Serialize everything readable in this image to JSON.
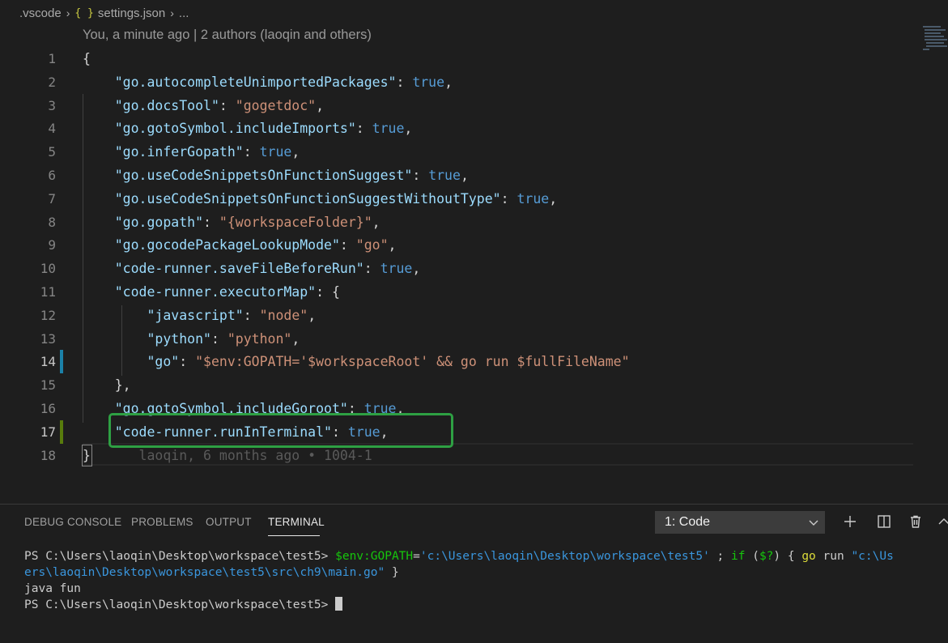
{
  "breadcrumb": {
    "folder": ".vscode",
    "file_icon_text": "{ }",
    "file": "settings.json",
    "more": "..."
  },
  "codelens": "You, a minute ago | 2 authors (laoqin and others)",
  "editor": {
    "line_numbers": [
      "1",
      "2",
      "3",
      "4",
      "5",
      "6",
      "7",
      "8",
      "9",
      "10",
      "11",
      "12",
      "13",
      "14",
      "15",
      "16",
      "17",
      "18"
    ],
    "lines": [
      [
        {
          "t": "{",
          "c": "p"
        }
      ],
      [
        {
          "t": "    ",
          "c": "p"
        },
        {
          "t": "\"go.autocompleteUnimportedPackages\"",
          "c": "k"
        },
        {
          "t": ": ",
          "c": "p"
        },
        {
          "t": "true",
          "c": "b"
        },
        {
          "t": ",",
          "c": "p"
        }
      ],
      [
        {
          "t": "    ",
          "c": "p"
        },
        {
          "t": "\"go.docsTool\"",
          "c": "k"
        },
        {
          "t": ": ",
          "c": "p"
        },
        {
          "t": "\"gogetdoc\"",
          "c": "s"
        },
        {
          "t": ",",
          "c": "p"
        }
      ],
      [
        {
          "t": "    ",
          "c": "p"
        },
        {
          "t": "\"go.gotoSymbol.includeImports\"",
          "c": "k"
        },
        {
          "t": ": ",
          "c": "p"
        },
        {
          "t": "true",
          "c": "b"
        },
        {
          "t": ",",
          "c": "p"
        }
      ],
      [
        {
          "t": "    ",
          "c": "p"
        },
        {
          "t": "\"go.inferGopath\"",
          "c": "k"
        },
        {
          "t": ": ",
          "c": "p"
        },
        {
          "t": "true",
          "c": "b"
        },
        {
          "t": ",",
          "c": "p"
        }
      ],
      [
        {
          "t": "    ",
          "c": "p"
        },
        {
          "t": "\"go.useCodeSnippetsOnFunctionSuggest\"",
          "c": "k"
        },
        {
          "t": ": ",
          "c": "p"
        },
        {
          "t": "true",
          "c": "b"
        },
        {
          "t": ",",
          "c": "p"
        }
      ],
      [
        {
          "t": "    ",
          "c": "p"
        },
        {
          "t": "\"go.useCodeSnippetsOnFunctionSuggestWithoutType\"",
          "c": "k"
        },
        {
          "t": ": ",
          "c": "p"
        },
        {
          "t": "true",
          "c": "b"
        },
        {
          "t": ",",
          "c": "p"
        }
      ],
      [
        {
          "t": "    ",
          "c": "p"
        },
        {
          "t": "\"go.gopath\"",
          "c": "k"
        },
        {
          "t": ": ",
          "c": "p"
        },
        {
          "t": "\"{workspaceFolder}\"",
          "c": "s"
        },
        {
          "t": ",",
          "c": "p"
        }
      ],
      [
        {
          "t": "    ",
          "c": "p"
        },
        {
          "t": "\"go.gocodePackageLookupMode\"",
          "c": "k"
        },
        {
          "t": ": ",
          "c": "p"
        },
        {
          "t": "\"go\"",
          "c": "s"
        },
        {
          "t": ",",
          "c": "p"
        }
      ],
      [
        {
          "t": "    ",
          "c": "p"
        },
        {
          "t": "\"code-runner.saveFileBeforeRun\"",
          "c": "k"
        },
        {
          "t": ": ",
          "c": "p"
        },
        {
          "t": "true",
          "c": "b"
        },
        {
          "t": ",",
          "c": "p"
        }
      ],
      [
        {
          "t": "    ",
          "c": "p"
        },
        {
          "t": "\"code-runner.executorMap\"",
          "c": "k"
        },
        {
          "t": ": {",
          "c": "p"
        }
      ],
      [
        {
          "t": "        ",
          "c": "p"
        },
        {
          "t": "\"javascript\"",
          "c": "k"
        },
        {
          "t": ": ",
          "c": "p"
        },
        {
          "t": "\"node\"",
          "c": "s"
        },
        {
          "t": ",",
          "c": "p"
        }
      ],
      [
        {
          "t": "        ",
          "c": "p"
        },
        {
          "t": "\"python\"",
          "c": "k"
        },
        {
          "t": ": ",
          "c": "p"
        },
        {
          "t": "\"python\"",
          "c": "s"
        },
        {
          "t": ",",
          "c": "p"
        }
      ],
      [
        {
          "t": "        ",
          "c": "p"
        },
        {
          "t": "\"go\"",
          "c": "k"
        },
        {
          "t": ": ",
          "c": "p"
        },
        {
          "t": "\"$env:GOPATH='$workspaceRoot' && go run $fullFileName\"",
          "c": "s"
        }
      ],
      [
        {
          "t": "    },",
          "c": "p"
        }
      ],
      [
        {
          "t": "    ",
          "c": "p"
        },
        {
          "t": "\"go.gotoSymbol.includeGoroot\"",
          "c": "k"
        },
        {
          "t": ": ",
          "c": "p"
        },
        {
          "t": "true",
          "c": "b"
        },
        {
          "t": ",",
          "c": "p"
        }
      ],
      [
        {
          "t": "    ",
          "c": "p"
        },
        {
          "t": "\"code-runner.runInTerminal\"",
          "c": "k"
        },
        {
          "t": ": ",
          "c": "p"
        },
        {
          "t": "true",
          "c": "b"
        },
        {
          "t": ",",
          "c": "p"
        }
      ],
      [
        {
          "t": "}",
          "c": "p"
        },
        {
          "t": "      laoqin, 6 months ago • 1004-1",
          "c": "blame"
        }
      ]
    ]
  },
  "panel": {
    "tabs": [
      {
        "label": "DEBUG CONSOLE",
        "active": false
      },
      {
        "label": "PROBLEMS",
        "active": false
      },
      {
        "label": "OUTPUT",
        "active": false
      },
      {
        "label": "TERMINAL",
        "active": true
      }
    ],
    "terminal_select": "1: Code",
    "icons": [
      "plus-icon",
      "split-icon",
      "trash-icon",
      "chevron-up-icon"
    ]
  },
  "terminal": {
    "lines": [
      [
        {
          "t": "PS C:\\Users\\laoqin\\Desktop\\workspace\\test5> ",
          "c": "t-w"
        },
        {
          "t": "$env:GOPATH",
          "c": "t-grn"
        },
        {
          "t": "=",
          "c": "t-w"
        },
        {
          "t": "'c:\\Users\\laoqin\\Desktop\\workspace\\test5'",
          "c": "t-cyan"
        },
        {
          "t": " ; ",
          "c": "t-w"
        },
        {
          "t": "if",
          "c": "t-grn"
        },
        {
          "t": " (",
          "c": "t-w"
        },
        {
          "t": "$?",
          "c": "t-grn"
        },
        {
          "t": ") { ",
          "c": "t-w"
        },
        {
          "t": "go",
          "c": "t-yel"
        },
        {
          "t": " run ",
          "c": "t-w"
        },
        {
          "t": "\"c:\\Us",
          "c": "t-cyan"
        }
      ],
      [
        {
          "t": "ers\\laoqin\\Desktop\\workspace\\test5\\src\\ch9\\main.go\"",
          "c": "t-cyan"
        },
        {
          "t": " }",
          "c": "t-w"
        }
      ],
      [
        {
          "t": "java fun",
          "c": "t-w"
        }
      ],
      [
        {
          "t": "PS C:\\Users\\laoqin\\Desktop\\workspace\\test5> ",
          "c": "t-w"
        }
      ]
    ]
  }
}
